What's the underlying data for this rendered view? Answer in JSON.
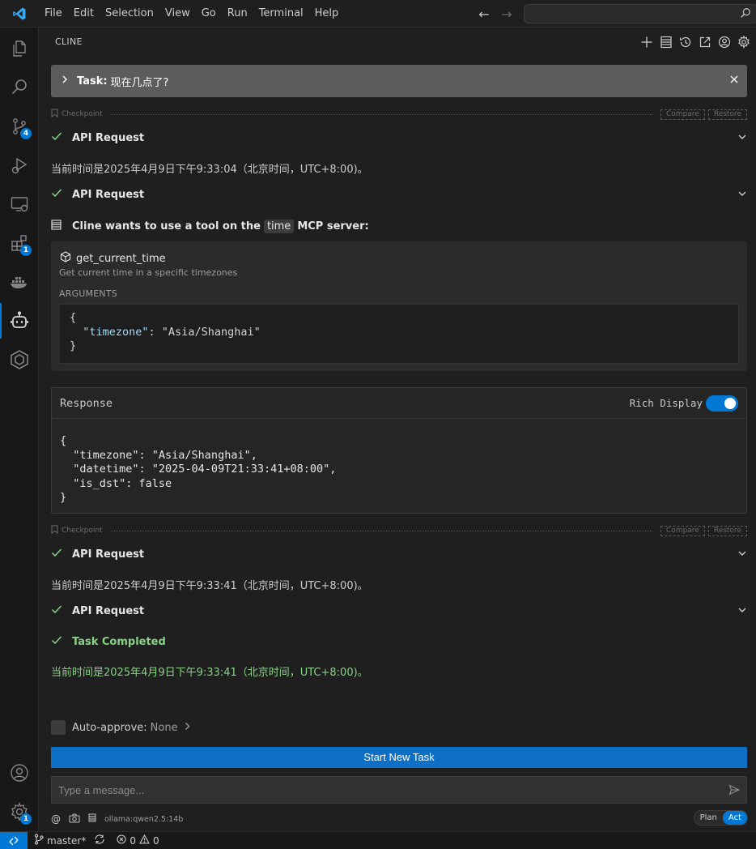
{
  "menu": [
    "File",
    "Edit",
    "Selection",
    "View",
    "Go",
    "Run",
    "Terminal",
    "Help"
  ],
  "activity": {
    "scm_badge": "4",
    "extensions_badge": "1",
    "settings_badge": "1"
  },
  "panel": {
    "title": "CLINE"
  },
  "task": {
    "label": "Task:",
    "text": "现在几点了?"
  },
  "checkpoint": {
    "label": "Checkpoint",
    "compare": "Compare",
    "restore": "Restore"
  },
  "api_request": "API Request",
  "answer1": "当前时间是2025年4月9日下午9:33:04（北京时间，UTC+8:00)。",
  "tool_use": {
    "prefix": "Cline wants to use a tool on the",
    "server": "time",
    "suffix": "MCP server:",
    "tool_name": "get_current_time",
    "tool_desc": "Get current time in a specific timezones",
    "args_label": "ARGUMENTS",
    "arg_key": "\"timezone\"",
    "arg_val": ": \"Asia/Shanghai\""
  },
  "response": {
    "title": "Response",
    "rich_display": "Rich Display",
    "rich_on": true,
    "code": "{\n  \"timezone\": \"Asia/Shanghai\",\n  \"datetime\": \"2025-04-09T21:33:41+08:00\",\n  \"is_dst\": false\n}"
  },
  "answer2": "当前时间是2025年4月9日下午9:33:41（北京时间，UTC+8:00)。",
  "task_completed": "Task Completed",
  "final_answer": "当前时间是2025年4月9日下午9:33:41（北京时间，UTC+8:00)。",
  "auto_approve": {
    "label": "Auto-approve:",
    "value": "None"
  },
  "start_new_task": "Start New Task",
  "message_placeholder": "Type a message...",
  "model": "ollama:qwen2.5:14b",
  "mode": {
    "plan": "Plan",
    "act": "Act",
    "active": "Act"
  },
  "status": {
    "branch": "master*",
    "errors": "0",
    "warnings": "0"
  },
  "colors": {
    "accent": "#0078d4",
    "success": "#89d185"
  }
}
